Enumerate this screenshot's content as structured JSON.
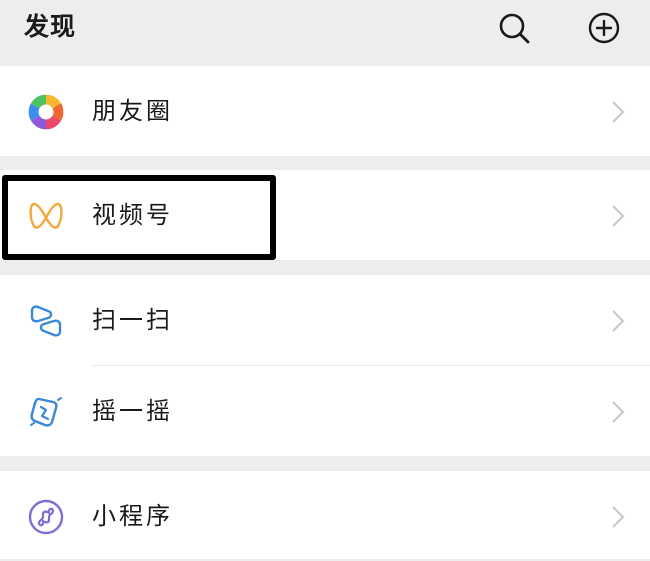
{
  "header": {
    "title": "发现",
    "search_icon": "search-icon",
    "add_icon": "plus-circle-icon"
  },
  "menu": {
    "moments": {
      "label": "朋友圈",
      "icon": "moments-aperture-icon"
    },
    "channels": {
      "label": "视频号",
      "icon": "channels-icon"
    },
    "scan": {
      "label": "扫一扫",
      "icon": "scan-icon"
    },
    "shake": {
      "label": "摇一摇",
      "icon": "shake-icon"
    },
    "mini_programs": {
      "label": "小程序",
      "icon": "mini-program-icon"
    }
  },
  "colors": {
    "background": "#ededed",
    "card": "#ffffff",
    "channels_accent": "#f2a93b",
    "scan_blue": "#3a88d8",
    "mini_program_purple": "#7b6fd6",
    "highlight_border": "#000000"
  }
}
